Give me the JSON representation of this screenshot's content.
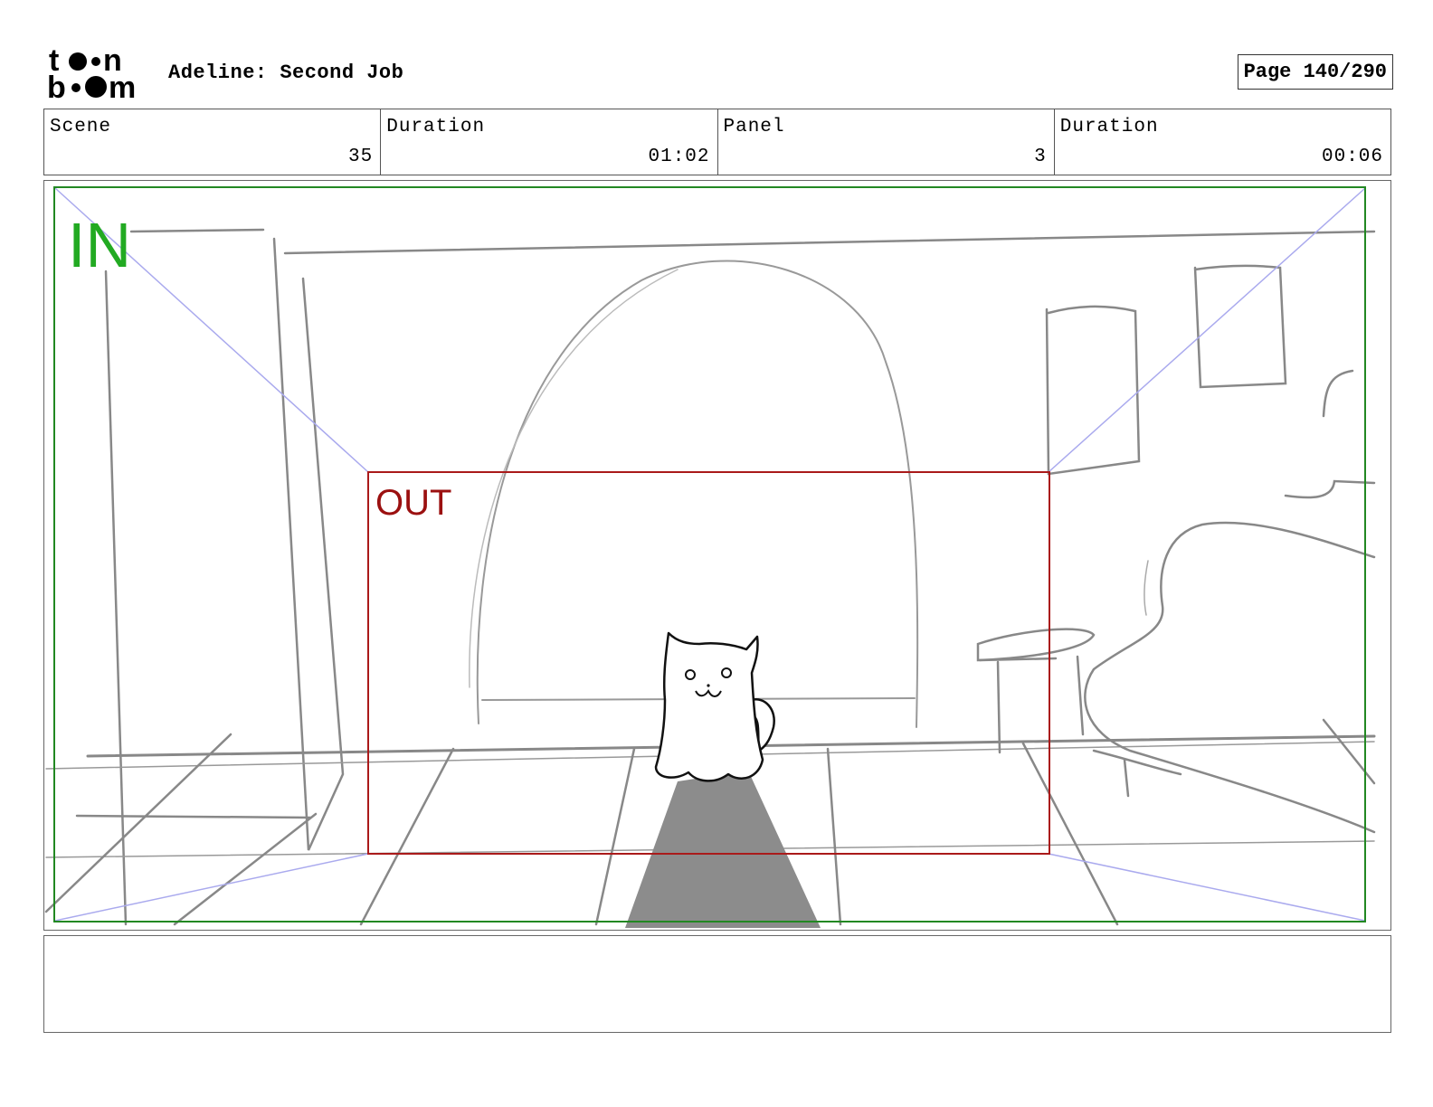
{
  "header": {
    "logo_text_top": "toon",
    "logo_text_bottom": "boom",
    "project_title": "Adeline: Second Job",
    "page_label": "Page 140/290"
  },
  "info": {
    "scene_label": "Scene",
    "scene_value": "35",
    "scene_duration_label": "Duration",
    "scene_duration_value": "01:02",
    "panel_label": "Panel",
    "panel_value": "3",
    "panel_duration_label": "Duration",
    "panel_duration_value": "00:06"
  },
  "panel": {
    "in_label": "IN",
    "out_label": "OUT",
    "in_color": "#22aa22",
    "out_color": "#9b1010"
  },
  "notes": {
    "text": ""
  }
}
